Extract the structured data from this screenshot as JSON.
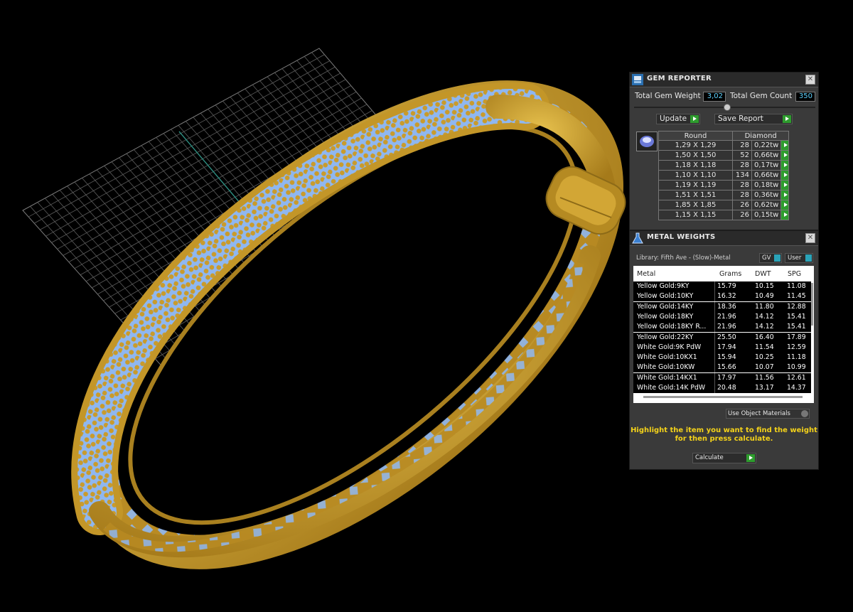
{
  "gem_reporter": {
    "title": "GEM REPORTER",
    "total_gem_weight_label": "Total Gem Weight",
    "total_gem_weight": "3,02",
    "total_gem_count_label": "Total Gem Count",
    "total_gem_count": "350",
    "update_label": "Update",
    "save_report_label": "Save Report",
    "shape_header": "Round",
    "material_header": "Diamond",
    "rows": [
      {
        "size": "1,29 X 1,29",
        "count": "28",
        "tw": "0,22tw"
      },
      {
        "size": "1,50 X 1,50",
        "count": "52",
        "tw": "0,66tw"
      },
      {
        "size": "1,18 X 1,18",
        "count": "28",
        "tw": "0,17tw"
      },
      {
        "size": "1,10 X 1,10",
        "count": "134",
        "tw": "0,66tw"
      },
      {
        "size": "1,19 X 1,19",
        "count": "28",
        "tw": "0,18tw"
      },
      {
        "size": "1,51 X 1,51",
        "count": "28",
        "tw": "0,36tw"
      },
      {
        "size": "1,85 X 1,85",
        "count": "26",
        "tw": "0,62tw"
      },
      {
        "size": "1,15 X 1,15",
        "count": "26",
        "tw": "0,15tw"
      }
    ]
  },
  "metal_weights": {
    "title": "METAL WEIGHTS",
    "library": "Library: Fifth Ave - (Slow)-Metal",
    "gv_label": "GV",
    "user_label": "User",
    "columns": [
      "Metal",
      "Grams",
      "DWT",
      "SPG"
    ],
    "rows": [
      {
        "metal": "Yellow Gold:9KY",
        "grams": "15.79",
        "dwt": "10.15",
        "spg": "11.08"
      },
      {
        "metal": "Yellow Gold:10KY",
        "grams": "16.32",
        "dwt": "10.49",
        "spg": "11.45"
      },
      {
        "metal": "Yellow Gold:14KY",
        "grams": "18.36",
        "dwt": "11.80",
        "spg": "12.88"
      },
      {
        "metal": "Yellow Gold:18KY",
        "grams": "21.96",
        "dwt": "14.12",
        "spg": "15.41"
      },
      {
        "metal": "Yellow Gold:18KY R...",
        "grams": "21.96",
        "dwt": "14.12",
        "spg": "15.41"
      },
      {
        "metal": "Yellow Gold:22KY",
        "grams": "25.50",
        "dwt": "16.40",
        "spg": "17.89"
      },
      {
        "metal": "White Gold:9K PdW",
        "grams": "17.94",
        "dwt": "11.54",
        "spg": "12.59"
      },
      {
        "metal": "White Gold:10KX1",
        "grams": "15.94",
        "dwt": "10.25",
        "spg": "11.18"
      },
      {
        "metal": "White Gold:10KW",
        "grams": "15.66",
        "dwt": "10.07",
        "spg": "10.99"
      },
      {
        "metal": "White Gold:14KX1",
        "grams": "17.97",
        "dwt": "11.56",
        "spg": "12.61"
      },
      {
        "metal": "White Gold:14K PdW",
        "grams": "20.48",
        "dwt": "13.17",
        "spg": "14.37"
      }
    ],
    "materials_select": "Use Object Materials",
    "instruction_line1": "Highlight the item you want to find the weight",
    "instruction_line2": "for then press calculate.",
    "calculate_label": "Calculate"
  },
  "colors": {
    "gold": "#c9a23a",
    "gem_blue": "#8fb7f0",
    "instruction_yellow": "#f4d21a",
    "value_cyan": "#5fd3ff",
    "button_green": "#2e9c2e"
  }
}
